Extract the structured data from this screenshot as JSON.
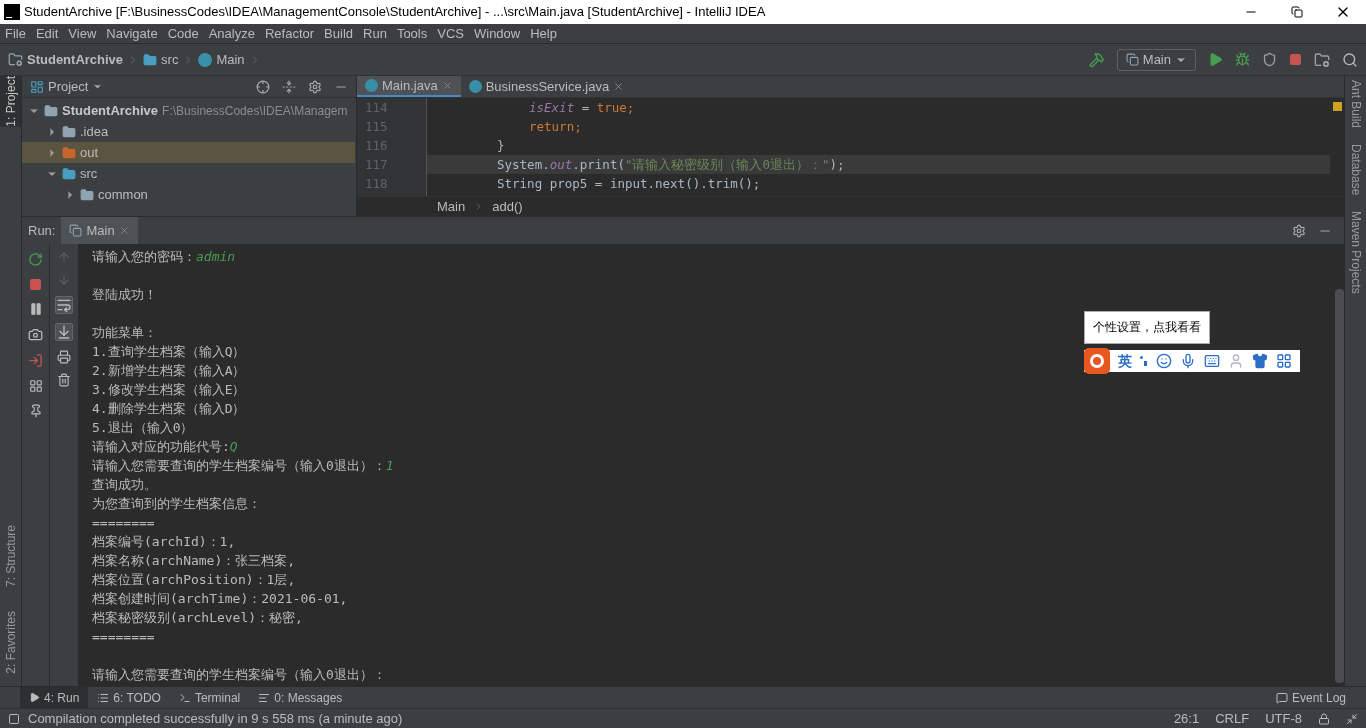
{
  "window": {
    "title": "StudentArchive [F:\\BusinessCodes\\IDEA\\ManagementConsole\\StudentArchive] - ...\\src\\Main.java [StudentArchive] - IntelliJ IDEA"
  },
  "menu": [
    "File",
    "Edit",
    "View",
    "Navigate",
    "Code",
    "Analyze",
    "Refactor",
    "Build",
    "Run",
    "Tools",
    "VCS",
    "Window",
    "Help"
  ],
  "breadcrumbs": [
    "StudentArchive",
    "src",
    "Main"
  ],
  "run_config": "Main",
  "left_stripe": [
    {
      "label": "1: Project",
      "selected": true
    },
    {
      "label": "7: Structure",
      "selected": false
    },
    {
      "label": "2: Favorites",
      "selected": false
    }
  ],
  "right_stripe": [
    "Ant Build",
    "Database",
    "Maven Projects"
  ],
  "project_panel": {
    "title": "Project",
    "tree": [
      {
        "name": "StudentArchive",
        "path": "F:\\BusinessCodes\\IDEA\\Managem",
        "kind": "module",
        "expanded": true,
        "selected": false,
        "children": [
          {
            "name": ".idea",
            "kind": "folder",
            "expanded": false,
            "selected": false
          },
          {
            "name": "out",
            "kind": "output",
            "expanded": false,
            "selected": true
          },
          {
            "name": "src",
            "kind": "source",
            "expanded": true,
            "selected": false,
            "children": [
              {
                "name": "common",
                "kind": "package",
                "expanded": false,
                "selected": false
              }
            ]
          }
        ]
      }
    ]
  },
  "editor_tabs": [
    {
      "label": "Main.java",
      "selected": true
    },
    {
      "label": "BusinessService.java",
      "selected": false
    }
  ],
  "code": [
    {
      "number": "114",
      "current": false,
      "tokens": [
        {
          "kind": "field",
          "text": "isExit"
        },
        {
          "kind": "plain",
          "text": " = "
        },
        {
          "kind": "keyword",
          "text": "true"
        },
        {
          "kind": "keyword",
          "text": ";"
        }
      ]
    },
    {
      "number": "115",
      "current": false,
      "tokens": [
        {
          "kind": "keyword",
          "text": "return"
        },
        {
          "kind": "keyword",
          "text": ";"
        }
      ]
    },
    {
      "number": "116",
      "current": false,
      "tokens": [
        {
          "kind": "plain",
          "text": "}"
        }
      ]
    },
    {
      "number": "117",
      "current": true,
      "tokens": [
        {
          "kind": "plain",
          "text": "System."
        },
        {
          "kind": "field",
          "text": "out"
        },
        {
          "kind": "plain",
          "text": ".print("
        },
        {
          "kind": "string",
          "text": "\"请输入秘密级别（输入0退出）：\""
        },
        {
          "kind": "plain",
          "text": ");"
        }
      ]
    },
    {
      "number": "118",
      "current": false,
      "tokens": [
        {
          "kind": "plain",
          "text": "String prop5 = input.next().trim();"
        }
      ]
    }
  ],
  "editor_breadcrumbs": [
    "Main",
    "add()"
  ],
  "run_panel": {
    "label": "Run:",
    "tab": "Main",
    "console": [
      {
        "kind": "line",
        "parts": [
          {
            "kind": "output",
            "text": "请输入您的密码："
          },
          {
            "kind": "input",
            "text": "admin"
          }
        ]
      },
      {
        "kind": "blank"
      },
      {
        "kind": "line",
        "parts": [
          {
            "kind": "output",
            "text": "登陆成功！"
          }
        ]
      },
      {
        "kind": "blank"
      },
      {
        "kind": "line",
        "parts": [
          {
            "kind": "output",
            "text": "功能菜单："
          }
        ]
      },
      {
        "kind": "line",
        "parts": [
          {
            "kind": "output",
            "text": "1.查询学生档案（输入Q）"
          }
        ]
      },
      {
        "kind": "line",
        "parts": [
          {
            "kind": "output",
            "text": "2.新增学生档案（输入A）"
          }
        ]
      },
      {
        "kind": "line",
        "parts": [
          {
            "kind": "output",
            "text": "3.修改学生档案（输入E）"
          }
        ]
      },
      {
        "kind": "line",
        "parts": [
          {
            "kind": "output",
            "text": "4.删除学生档案（输入D）"
          }
        ]
      },
      {
        "kind": "line",
        "parts": [
          {
            "kind": "output",
            "text": "5.退出（输入0）"
          }
        ]
      },
      {
        "kind": "line",
        "parts": [
          {
            "kind": "output",
            "text": "请输入对应的功能代号:"
          },
          {
            "kind": "input",
            "text": "Q"
          }
        ]
      },
      {
        "kind": "line",
        "parts": [
          {
            "kind": "output",
            "text": "请输入您需要查询的学生档案编号（输入0退出）："
          },
          {
            "kind": "input",
            "text": "1"
          }
        ]
      },
      {
        "kind": "line",
        "parts": [
          {
            "kind": "output",
            "text": "查询成功。"
          }
        ]
      },
      {
        "kind": "line",
        "parts": [
          {
            "kind": "output",
            "text": "为您查询到的学生档案信息："
          }
        ]
      },
      {
        "kind": "line",
        "parts": [
          {
            "kind": "output",
            "text": "========"
          }
        ]
      },
      {
        "kind": "line",
        "parts": [
          {
            "kind": "output",
            "text": "档案编号(archId)：1,"
          }
        ]
      },
      {
        "kind": "line",
        "parts": [
          {
            "kind": "output",
            "text": "档案名称(archName)：张三档案,"
          }
        ]
      },
      {
        "kind": "line",
        "parts": [
          {
            "kind": "output",
            "text": "档案位置(archPosition)：1层,"
          }
        ]
      },
      {
        "kind": "line",
        "parts": [
          {
            "kind": "output",
            "text": "档案创建时间(archTime)：2021-06-01,"
          }
        ]
      },
      {
        "kind": "line",
        "parts": [
          {
            "kind": "output",
            "text": "档案秘密级别(archLevel)：秘密,"
          }
        ]
      },
      {
        "kind": "line",
        "parts": [
          {
            "kind": "output",
            "text": "========"
          }
        ]
      },
      {
        "kind": "blank"
      },
      {
        "kind": "line",
        "parts": [
          {
            "kind": "output",
            "text": "请输入您需要查询的学生档案编号（输入0退出）："
          }
        ]
      }
    ]
  },
  "ime": {
    "tooltip": "个性设置，点我看看",
    "mode": "英"
  },
  "bottom_tabs": [
    {
      "label": "4: Run",
      "selected": true
    },
    {
      "label": "6: TODO",
      "selected": false
    },
    {
      "label": "Terminal",
      "selected": false
    },
    {
      "label": "0: Messages",
      "selected": false
    }
  ],
  "event_log": "Event Log",
  "status_bar": {
    "message": "Compilation completed successfully in 9 s 558 ms (a minute ago)",
    "position": "26:1",
    "line_separator": "CRLF",
    "encoding": "UTF-8"
  }
}
